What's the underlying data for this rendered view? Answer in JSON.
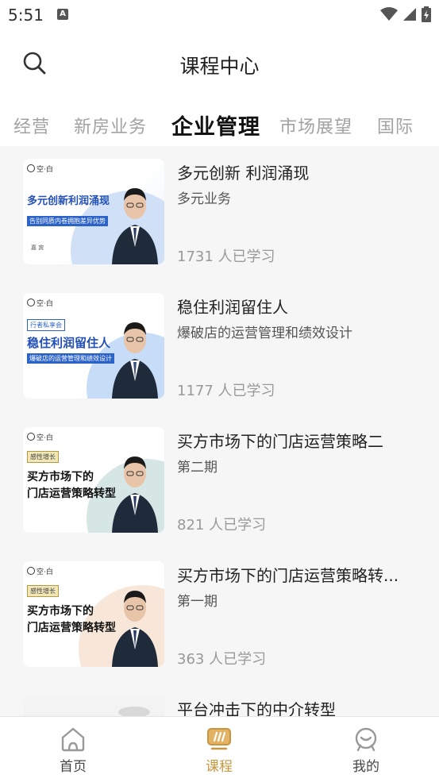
{
  "status_bar": {
    "time": "5:51",
    "notification_icon": "A"
  },
  "header": {
    "title": "课程中心",
    "search_icon": "search-icon"
  },
  "tabs": [
    {
      "label": "经营",
      "active": false
    },
    {
      "label": "新房业务",
      "active": false
    },
    {
      "label": "企业管理",
      "active": true
    },
    {
      "label": "市场展望",
      "active": false
    },
    {
      "label": "国际",
      "active": false
    }
  ],
  "courses": [
    {
      "title": "多元创新 利润涌现",
      "subtitle": "多元业务",
      "learners": "1731 人已学习",
      "thumb": {
        "logo": "空·白",
        "line1": "多元创新利润涌现",
        "bar": "告别同质内卷拥抱差异优势",
        "speaker": "嘉 宾"
      }
    },
    {
      "title": "稳住利润留住人",
      "subtitle": "爆破店的运营管理和绩效设计",
      "learners": "1177 人已学习",
      "thumb": {
        "logo": "空·白",
        "tag": "行者私享会",
        "line1": "稳住利润留住人",
        "bar": "爆破店的运营管理和绩效设计"
      }
    },
    {
      "title": "买方市场下的门店运营策略二",
      "subtitle": "第二期",
      "learners": "821 人已学习",
      "thumb": {
        "logo": "空·白",
        "tag": "感性增长",
        "line1": "买方市场下的",
        "line2": "门店运营策略转型"
      }
    },
    {
      "title": "买方市场下的门店运营策略转...",
      "subtitle": "第一期",
      "learners": "363 人已学习",
      "thumb": {
        "logo": "空·白",
        "tag": "感性增长",
        "line1": "买方市场下的",
        "line2": "门店运营策略转型"
      }
    },
    {
      "title": "平台冲击下的中介转型",
      "subtitle": "",
      "learners": "",
      "thumb": {}
    }
  ],
  "bottom_nav": [
    {
      "label": "首页",
      "icon": "home-icon",
      "active": false
    },
    {
      "label": "课程",
      "icon": "course-icon",
      "active": true
    },
    {
      "label": "我的",
      "icon": "profile-icon",
      "active": false
    }
  ],
  "colors": {
    "accent": "#c8963e",
    "list_bg": "#f6f6f6",
    "tab_inactive": "#a2a2a2"
  }
}
